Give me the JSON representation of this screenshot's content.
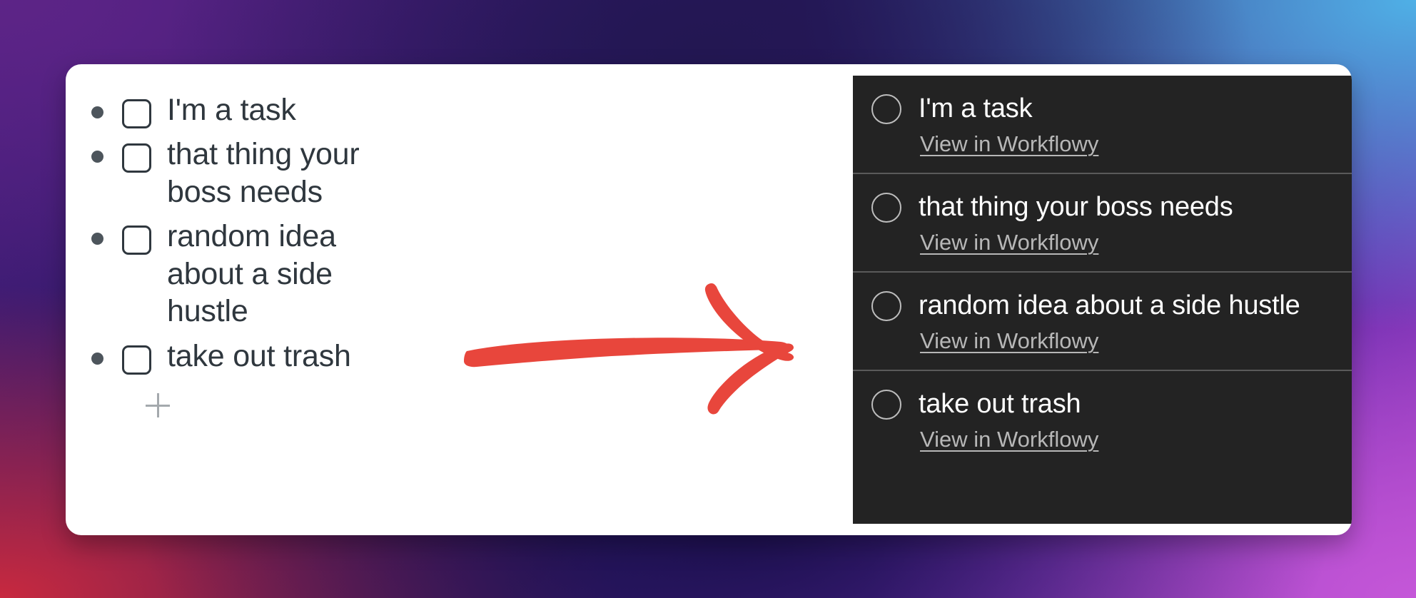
{
  "theme": {
    "card_background": "#ffffff",
    "dark_panel_background": "#232323",
    "arrow_color": "#e8463c",
    "outline_text_color": "#2f373e",
    "task_text_color": "#ffffff",
    "link_color": "#b7b7b7",
    "divider_color": "#5a5a5a",
    "backdrop_colors": [
      "#5d2487",
      "#26165e",
      "#4fb0e6",
      "#c8293f",
      "#c457d8"
    ]
  },
  "outline": {
    "items": [
      {
        "text": "I'm a task",
        "checked": false
      },
      {
        "text": "that thing your boss needs",
        "checked": false
      },
      {
        "text": "random idea about a side hustle",
        "checked": false
      },
      {
        "text": "take out trash",
        "checked": false
      }
    ],
    "add_icon": "plus-icon"
  },
  "tasks": {
    "link_label": "View in Workflowy",
    "items": [
      {
        "title": "I'm a task",
        "link": "View in Workflowy",
        "completed": false
      },
      {
        "title": "that thing your boss needs",
        "link": "View in Workflowy",
        "completed": false
      },
      {
        "title": "random idea about a side hustle",
        "link": "View in Workflowy",
        "completed": false
      },
      {
        "title": "take out trash",
        "link": "View in Workflowy",
        "completed": false
      }
    ]
  },
  "annotation": {
    "arrow_icon": "arrow-right-hand-drawn",
    "direction": "left-to-right"
  }
}
